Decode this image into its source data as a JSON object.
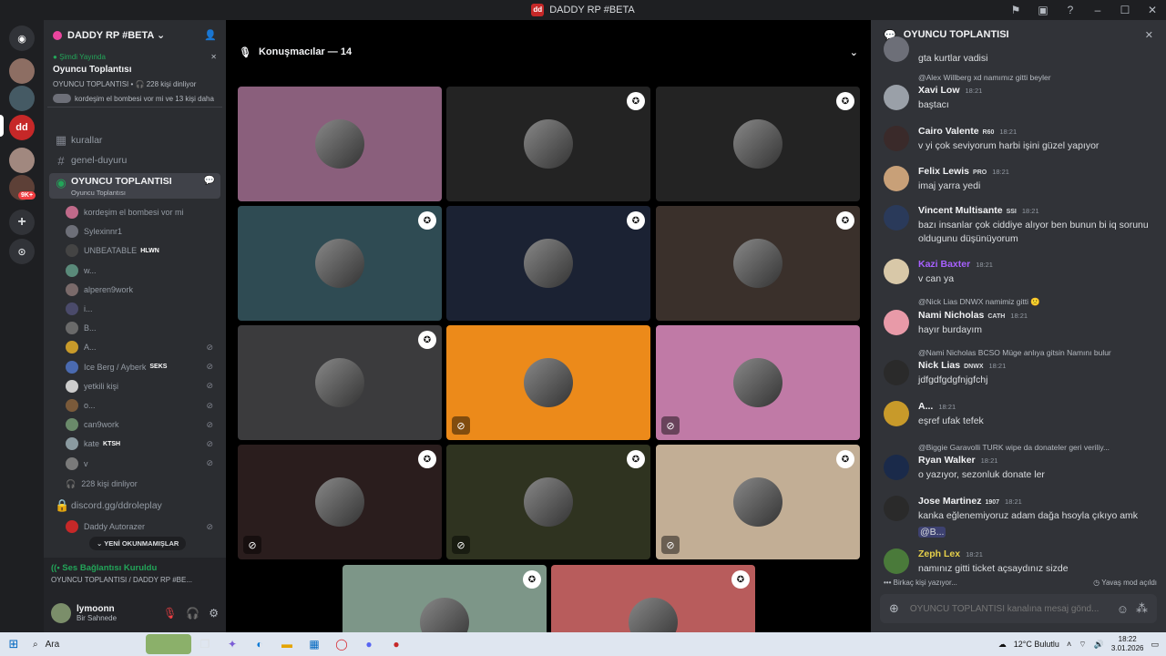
{
  "window": {
    "title": "DADDY RP #BETA",
    "app_badge": "dd"
  },
  "servers": {
    "badge_count": "9K+"
  },
  "guild": {
    "name": "DADDY RP #BETA"
  },
  "live": {
    "status": "Şimdi Yayında",
    "title": "Oyuncu Toplantısı",
    "meta": "OYUNCU TOPLANTISI • 🎧 228 kişi dinliyor",
    "preview": "kordeşim el bombesi vor mi ve 13 kişi daha"
  },
  "channels": {
    "rules": "kurallar",
    "general": "genel-duyuru",
    "voice_name": "OYUNCU TOPLANTISI",
    "voice_sub": "Oyuncu Toplantısı",
    "listeners": "228 kişi dinliyor",
    "invite": "discord.gg/ddroleplay",
    "autorazer": "Daddy Autorazer",
    "unread": "YENİ OKUNMAMIŞLAR"
  },
  "members": [
    {
      "name": "kordeşim el bombesi vor mi",
      "tag": "",
      "muted": false
    },
    {
      "name": "Sylexinnr1",
      "tag": "",
      "muted": false
    },
    {
      "name": "UNBEATABLE",
      "tag": "HLWN",
      "muted": false
    },
    {
      "name": "w...",
      "tag": "",
      "muted": false
    },
    {
      "name": "alperen9work",
      "tag": "",
      "muted": false
    },
    {
      "name": "i...",
      "tag": "",
      "muted": false
    },
    {
      "name": "B...",
      "tag": "",
      "muted": false
    },
    {
      "name": "A...",
      "tag": "",
      "muted": true
    },
    {
      "name": "Ice Berg / Ayberk",
      "tag": "SEKS",
      "muted": true
    },
    {
      "name": "yetkili kişi",
      "tag": "",
      "muted": true
    },
    {
      "name": "o...",
      "tag": "",
      "muted": true
    },
    {
      "name": "can9work",
      "tag": "",
      "muted": true
    },
    {
      "name": "kate",
      "tag": "KTSH",
      "muted": true
    },
    {
      "name": "v",
      "tag": "",
      "muted": true
    }
  ],
  "voice_status": {
    "title": "Ses Bağlantısı Kuruldu",
    "sub": "OYUNCU TOPLANTISI / DADDY RP #BE..."
  },
  "user": {
    "name": "lymoonn",
    "status": "Bir Sahnede"
  },
  "stage": {
    "speakers": "Konuşmacılar — 14"
  },
  "tiles": [
    {
      "color": "#8a5f7c",
      "shield": false,
      "muted": false
    },
    {
      "color": "#232323",
      "shield": true,
      "muted": false
    },
    {
      "color": "#232323",
      "shield": true,
      "muted": false
    },
    {
      "color": "#2f4b53",
      "shield": true,
      "muted": false
    },
    {
      "color": "#1b2233",
      "shield": true,
      "muted": false
    },
    {
      "color": "#3a302b",
      "shield": true,
      "muted": false
    },
    {
      "color": "#3b3b3d",
      "shield": true,
      "muted": false
    },
    {
      "color": "#ec8a1a",
      "shield": false,
      "muted": true
    },
    {
      "color": "#c07aa6",
      "shield": false,
      "muted": true
    },
    {
      "color": "#2a1d1d",
      "shield": true,
      "muted": true
    },
    {
      "color": "#2f3320",
      "shield": true,
      "muted": true
    },
    {
      "color": "#c2ae95",
      "shield": true,
      "muted": true
    },
    {
      "color": "#7d9688",
      "shield": true,
      "muted": false
    },
    {
      "color": "#b85c5c",
      "shield": true,
      "muted": false
    }
  ],
  "chat": {
    "title": "OYUNCU TOPLANTISI",
    "messages": [
      {
        "reply": "",
        "name": "",
        "badge": "",
        "time": "",
        "text": "gta kurtlar vadisi",
        "name_color": "#f2f3f5"
      },
      {
        "reply": "@Alex Willberg  xd  namımız gitti beyler",
        "name": "Xavi Low",
        "badge": "",
        "time": "18:21",
        "text": "baştacı",
        "name_color": "#f2f3f5"
      },
      {
        "reply": "",
        "name": "Cairo Valente",
        "badge": "R60",
        "time": "18:21",
        "text": "v yi çok seviyorum harbi işini güzel yapıyor",
        "name_color": "#f2f3f5"
      },
      {
        "reply": "",
        "name": "Felix Lewis",
        "badge": "PRO",
        "time": "18:21",
        "text": "imaj yarra yedi",
        "name_color": "#f2f3f5"
      },
      {
        "reply": "",
        "name": "Vincent Multisante",
        "badge": "SSI",
        "time": "18:21",
        "text": "bazı insanlar çok ciddiye alıyor ben bunun bi iq sorunu oldugunu düşünüyorum",
        "name_color": "#f2f3f5"
      },
      {
        "reply": "",
        "name": "Kazi Baxter",
        "badge": "",
        "time": "18:21",
        "text": "v can ya",
        "name_color": "#a760ff"
      },
      {
        "reply": "@Nick Lias  DNWX  namimiz gitti 🙁",
        "name": "Nami Nicholas",
        "badge": "CATH",
        "time": "18:21",
        "text": "hayır burdayım",
        "name_color": "#f2f3f5"
      },
      {
        "reply": "@Nami Nicholas  BCSO  Müge anlıya gitsin Namını bulur",
        "name": "Nick Lias",
        "badge": "DNWX",
        "time": "18:21",
        "text": "jdfgdfgdgfnjgfchj",
        "name_color": "#f2f3f5"
      },
      {
        "reply": "",
        "name": "A...",
        "badge": "",
        "time": "18:21",
        "text": "eşref ufak tefek",
        "name_color": "#f2f3f5"
      },
      {
        "reply": "@Biggie Garavolli  TURK  wipe da donateler geri veriliy...",
        "name": "Ryan Walker",
        "badge": "",
        "time": "18:21",
        "text": "o yazıyor, sezonluk donate ler",
        "name_color": "#f2f3f5"
      },
      {
        "reply": "",
        "name": "Jose Martinez",
        "badge": "1907",
        "time": "18:21",
        "text": "kanka eğlenemiyoruz adam dağa hsoyla çıkıyo amk",
        "mention": "@B...",
        "name_color": "#f2f3f5"
      },
      {
        "reply": "",
        "name": "Zeph Lex",
        "badge": "",
        "time": "18:21",
        "text": "namınız gitti ticket açsaydınız sizde",
        "name_color": "#e6d04a"
      }
    ],
    "typing": "Birkaç kişi yazıyor...",
    "slowmode": "Yavaş mod açıldı",
    "composer_placeholder": "OYUNCU TOPLANTISI kanalına mesaj gönd..."
  },
  "taskbar": {
    "search": "Ara",
    "weather": "12°C  Bulutlu",
    "time": "18:22",
    "date": "3.01.2026"
  }
}
